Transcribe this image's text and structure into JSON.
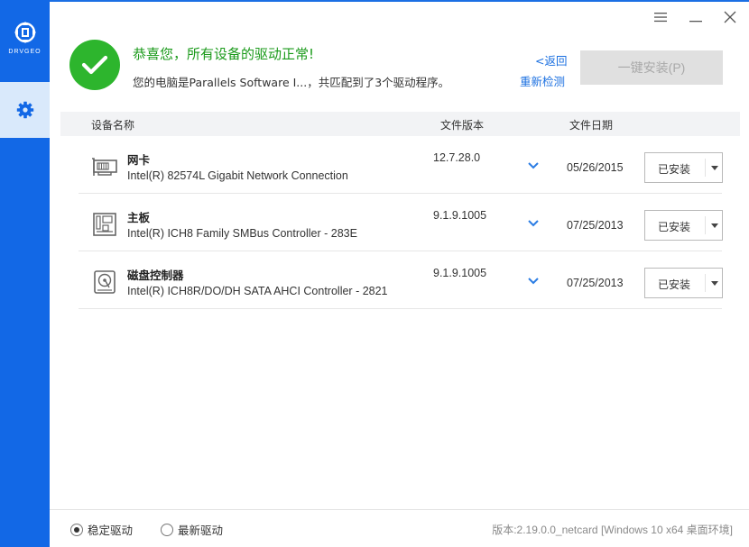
{
  "sidebar": {
    "logo_text": "DRVGEO",
    "nav": [
      {
        "icon": "gear-icon",
        "active": true
      }
    ]
  },
  "window_controls": [
    {
      "icon": "menu-icon"
    },
    {
      "icon": "minimize-icon"
    },
    {
      "icon": "close-icon"
    }
  ],
  "header": {
    "status_icon": "checkmark-icon",
    "title": "恭喜您，所有设备的驱动正常!",
    "subtitle": "您的电脑是Parallels Software I...，共匹配到了3个驱动程序。",
    "back_link": "<返回",
    "rescan_link": "重新检测",
    "install_button": "一键安装(P)"
  },
  "table": {
    "columns": {
      "name": "设备名称",
      "version": "文件版本",
      "date": "文件日期"
    },
    "rows": [
      {
        "icon": "network-card-icon",
        "name": "网卡",
        "desc": "Intel(R) 82574L Gigabit Network Connection",
        "version": "12.7.28.0",
        "date": "05/26/2015",
        "state": "已安装"
      },
      {
        "icon": "motherboard-icon",
        "name": "主板",
        "desc": "Intel(R) ICH8 Family SMBus Controller - 283E",
        "version": "9.1.9.1005",
        "date": "07/25/2013",
        "state": "已安装"
      },
      {
        "icon": "disk-controller-icon",
        "name": "磁盘控制器",
        "desc": "Intel(R) ICH8R/DO/DH SATA AHCI Controller - 2821",
        "version": "9.1.9.1005",
        "date": "07/25/2013",
        "state": "已安装"
      }
    ]
  },
  "footer": {
    "radio_stable": "稳定驱动",
    "radio_latest": "最新驱动",
    "selected": "stable",
    "version": "版本:2.19.0.0_netcard [Windows 10 x64 桌面环境]"
  },
  "colors": {
    "sidebar": "#1268e6",
    "success": "#2db52d",
    "link": "#1a6fe0",
    "button_disabled": "#e0e0e0"
  }
}
